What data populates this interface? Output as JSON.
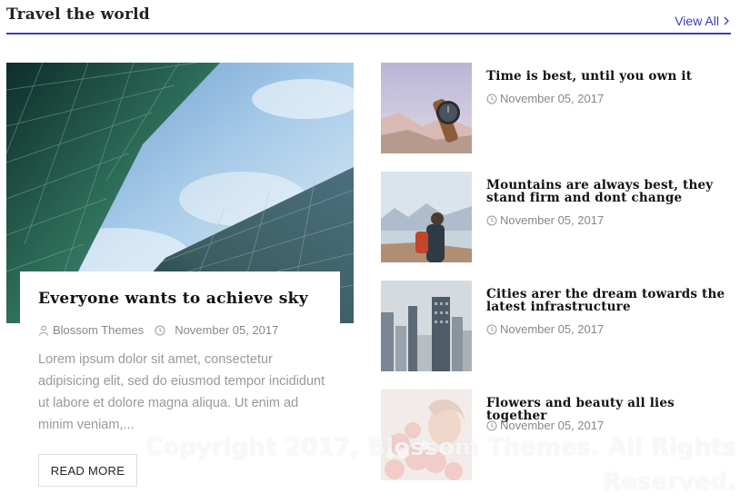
{
  "section": {
    "title": "Travel the world",
    "view_all_label": "View All",
    "accent_color": "#3a3fb8"
  },
  "featured": {
    "title": "Everyone wants to achieve sky",
    "author": "Blossom Themes",
    "date": "November 05, 2017",
    "excerpt": "Lorem ipsum dolor sit amet, consectetur adipisicing elit, sed do eiusmod tempor incididunt ut labore et dolore magna aliqua. Ut enim ad minim veniam,...",
    "read_more_label": "READ MORE",
    "image": "glass-skyscrapers-photo"
  },
  "posts": [
    {
      "title": "Time is best, until you own it",
      "date": "November 05, 2017",
      "image": "wristwatch-on-rocks-photo"
    },
    {
      "title": "Mountains are always best, they stand firm and dont change",
      "date": "November 05, 2017",
      "image": "hiker-with-backpack-photo"
    },
    {
      "title": "Cities arer the dream towards the latest infrastructure",
      "date": "November 05, 2017",
      "image": "city-skyline-photo"
    },
    {
      "title": "Flowers and beauty all lies together",
      "date": "November 05, 2017",
      "image": "woman-with-flowers-photo"
    }
  ],
  "watermark": "Copyright 2017, Blossom Themes. All Rights Reserved."
}
